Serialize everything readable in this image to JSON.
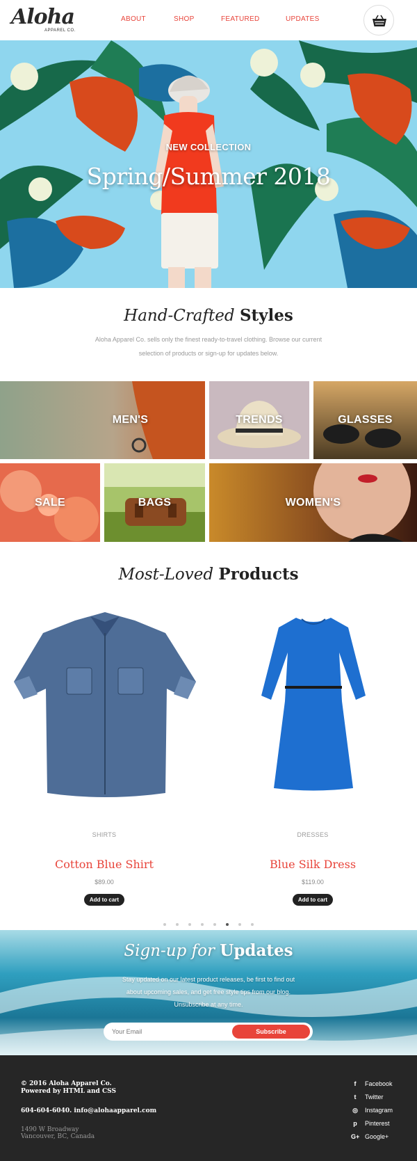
{
  "header": {
    "logo_main": "Aloha",
    "logo_sub": "APPAREL CO.",
    "nav": [
      "ABOUT",
      "SHOP",
      "FEATURED",
      "UPDATES"
    ],
    "cart_icon": "basket-icon"
  },
  "hero": {
    "kicker": "NEW COLLECTION",
    "title": "Spring/Summer 2018"
  },
  "intro": {
    "title_italic": "Hand-Crafted",
    "title_bold": "Styles",
    "text": "Aloha Apparel Co. sells only the finest ready-to-travel clothing. Browse our current selection of products or sign-up for updates below."
  },
  "categories": [
    "MEN'S",
    "TRENDS",
    "GLASSES",
    "SALE",
    "BAGS",
    "WOMEN'S"
  ],
  "products": {
    "title_italic": "Most-Loved",
    "title_bold": "Products",
    "items": [
      {
        "category": "SHIRTS",
        "name": "Cotton Blue Shirt",
        "price": "$89.00",
        "button": "Add to cart"
      },
      {
        "category": "DRESSES",
        "name": "Blue Silk Dress",
        "price": "$119.00",
        "button": "Add to cart"
      }
    ],
    "carousel_pages": 8,
    "carousel_active": 6
  },
  "signup": {
    "title_italic": "Sign-up for",
    "title_bold": "Updates",
    "text": "Stay updated on our latest product releases, be first to find out about upcoming sales, and get free style tips from our blog. Unsubscribe at any time.",
    "placeholder": "Your Email",
    "button": "Subscribe"
  },
  "footer": {
    "copyright": "© 2016 Aloha Apparel Co.",
    "powered": "Powered by HTML and CSS",
    "phone": "604-604-6040.",
    "email": "info@alohaapparel.com",
    "address_line1": "1490 W Broadway",
    "address_line2": "Vancouver, BC, Canada",
    "social": [
      {
        "icon": "f",
        "label": "Facebook"
      },
      {
        "icon": "t",
        "label": "Twitter"
      },
      {
        "icon": "◎",
        "label": "Instagram"
      },
      {
        "icon": "p",
        "label": "Pinterest"
      },
      {
        "icon": "G+",
        "label": "Google+"
      }
    ]
  },
  "colors": {
    "accent": "#e8443a",
    "footer_bg": "#262626",
    "hero_sky": "#8fd6ee",
    "ocean": "#2d93b2"
  }
}
